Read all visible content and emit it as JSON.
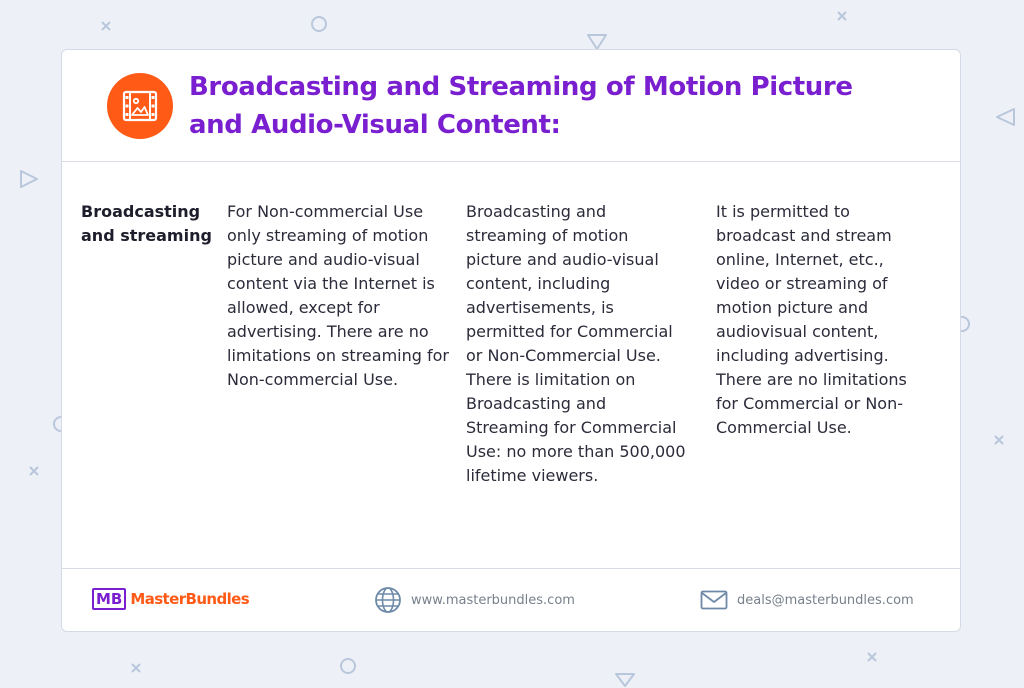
{
  "header": {
    "icon": "film-image-icon",
    "title_line1": "Broadcasting and Streaming of Motion Picture",
    "title_line2": "and Audio-Visual Content:"
  },
  "row": {
    "label": "Broadcasting and streaming",
    "col1": "For Non-commercial Use only streaming of motion picture and audio-visual content via the Internet is allowed, except for advertising. There are no limitations on streaming for Non-commercial Use.",
    "col2": "Broadcasting and streaming of motion picture and audio-visual content, including advertisements, is permitted for Commercial or Non-Commercial Use. There is limitation on Broadcasting and Streaming for Commercial Use: no more than 500,000 lifetime viewers.",
    "col3": "It is permitted to broadcast and stream online, Internet, etc., video or streaming of motion picture and audiovisual content, including advertising. There are no limitations for Commercial or Non-Commercial Use."
  },
  "footer": {
    "logo_mark": "MB",
    "logo_text": "MasterBundles",
    "website": "www.masterbundles.com",
    "email": "deals@masterbundles.com"
  },
  "colors": {
    "accent_orange": "#ff5b17",
    "accent_purple": "#7a1fd0",
    "background": "#edf1f7"
  }
}
